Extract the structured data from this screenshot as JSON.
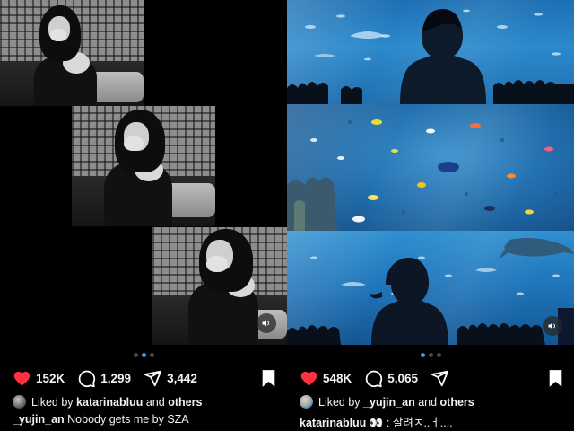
{
  "left_post": {
    "carousel": {
      "count": 3,
      "active_index": 1
    },
    "likes": "152K",
    "comments": "1,299",
    "shares": "3,442",
    "liked_by": {
      "prefix": "Liked by",
      "user": "katarinabluu",
      "connector": "and",
      "others": "others"
    },
    "caption": {
      "username": "_yujin_an",
      "text": "Nobody gets me by SZA"
    }
  },
  "right_post": {
    "carousel": {
      "count": 3,
      "active_index": 0
    },
    "likes": "548K",
    "comments": "5,065",
    "liked_by": {
      "prefix": "Liked by",
      "user": "_yujin_an",
      "connector": "and",
      "others": "others"
    },
    "caption": {
      "username": "katarinabluu",
      "emoji": "👀",
      "text": ": 살려ㅈ..ㅓ...."
    }
  },
  "icons": {
    "like": "heart-icon",
    "comment": "comment-icon",
    "share": "send-icon",
    "save": "bookmark-icon",
    "sound": "speaker-icon"
  },
  "colors": {
    "heart": "#ff3040",
    "dot_active": "#3897f0",
    "background": "#000000"
  }
}
